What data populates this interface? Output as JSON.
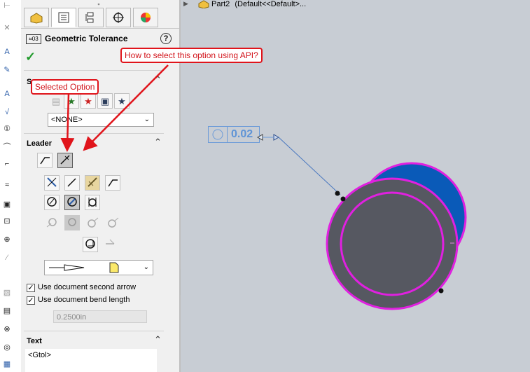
{
  "tree": {
    "part_label": "Part2",
    "config_label": "(Default<<Default>..."
  },
  "panel": {
    "title": "Geometric Tolerance",
    "help_symbol": "?",
    "ok_symbol": "✓",
    "style_section": {
      "title": "S",
      "dropdown_value": "<NONE>"
    },
    "leader_section": {
      "title": "Leader",
      "checkbox_second_arrow": "Use document second arrow",
      "checkbox_bend_length": "Use document bend length",
      "bend_length_value": "0.2500in"
    },
    "text_section": {
      "title": "Text",
      "text_value": "<Gtol>"
    }
  },
  "gtol_value": "0.02",
  "annotations": {
    "callout_api": "How to select this option using API?",
    "callout_selected": "Selected Option"
  },
  "colors": {
    "accent_red": "#e0141b",
    "circle_magenta": "#e020e0",
    "circle_blue": "#0a5ab8",
    "circle_gray": "#565861",
    "viewport_bg": "#c8cdd4"
  }
}
